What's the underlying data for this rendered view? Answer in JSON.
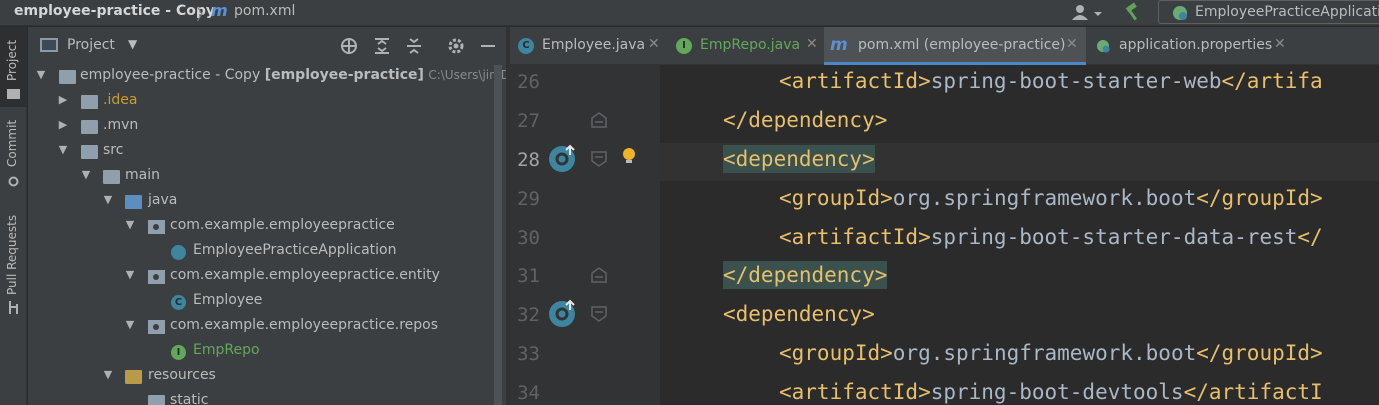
{
  "breadcrumb": {
    "project": "employee-practice - Copy",
    "separator": "〉",
    "file_icon": "m",
    "file": "pom.xml"
  },
  "toolbar": {
    "user_icon": "user-icon",
    "build_icon": "hammer-icon",
    "run_config_label": "EmployeePracticeApplication"
  },
  "stripe": {
    "tabs": [
      "Project",
      "Commit",
      "Pull Requests"
    ]
  },
  "project_panel": {
    "title": "Project",
    "tree": [
      {
        "label": "employee-practice - Copy",
        "module": "[employee-practice]",
        "path": "C:\\Users\\jin\\Do"
      },
      {
        "label": ".idea"
      },
      {
        "label": ".mvn"
      },
      {
        "label": "src"
      },
      {
        "label": "main"
      },
      {
        "label": "java"
      },
      {
        "label": "com.example.employeepractice"
      },
      {
        "label": "EmployeePracticeApplication"
      },
      {
        "label": "com.example.employeepractice.entity"
      },
      {
        "label": "Employee",
        "icon_letter": "C"
      },
      {
        "label": "com.example.employeepractice.repos"
      },
      {
        "label": "EmpRepo",
        "icon_letter": "I"
      },
      {
        "label": "resources"
      },
      {
        "label": "static"
      }
    ]
  },
  "editor_tabs": [
    {
      "label": "Employee.java",
      "icon": "C",
      "close": "✕"
    },
    {
      "label": "EmpRepo.java",
      "icon": "I",
      "close": "✕"
    },
    {
      "label": "pom.xml (employee-practice)",
      "icon": "m",
      "close": "✕",
      "active": true
    },
    {
      "label": "application.properties",
      "icon": "spring-icon",
      "close": "✕"
    }
  ],
  "editor": {
    "line_numbers": [
      "26",
      "27",
      "28",
      "29",
      "30",
      "31",
      "32",
      "33",
      "34"
    ],
    "lines": [
      {
        "open": "<artifactId>",
        "text": "spring-boot-starter-web",
        "close": "</artifa"
      },
      {
        "open": "",
        "text": "",
        "close": "</dependency>"
      },
      {
        "open": "<dependency>",
        "text": "",
        "close": ""
      },
      {
        "open": "<groupId>",
        "text": "org.springframework.boot",
        "close": "</groupId>"
      },
      {
        "open": "<artifactId>",
        "text": "spring-boot-starter-data-rest",
        "close": "</"
      },
      {
        "open": "",
        "text": "",
        "close": "</dependency>"
      },
      {
        "open": "<dependency>",
        "text": "",
        "close": ""
      },
      {
        "open": "<groupId>",
        "text": "org.springframework.boot",
        "close": "</groupId>"
      },
      {
        "open": "<artifactId>",
        "text": "spring-boot-devtools",
        "close": "</artifactI"
      }
    ]
  },
  "colors": {
    "accent": "#4a88c7",
    "tag": "#e8bf6a",
    "text": "#a9b7c6",
    "match_highlight": "#3b514d",
    "idea_folder": "#c89d2c",
    "interface": "#62a85a"
  }
}
